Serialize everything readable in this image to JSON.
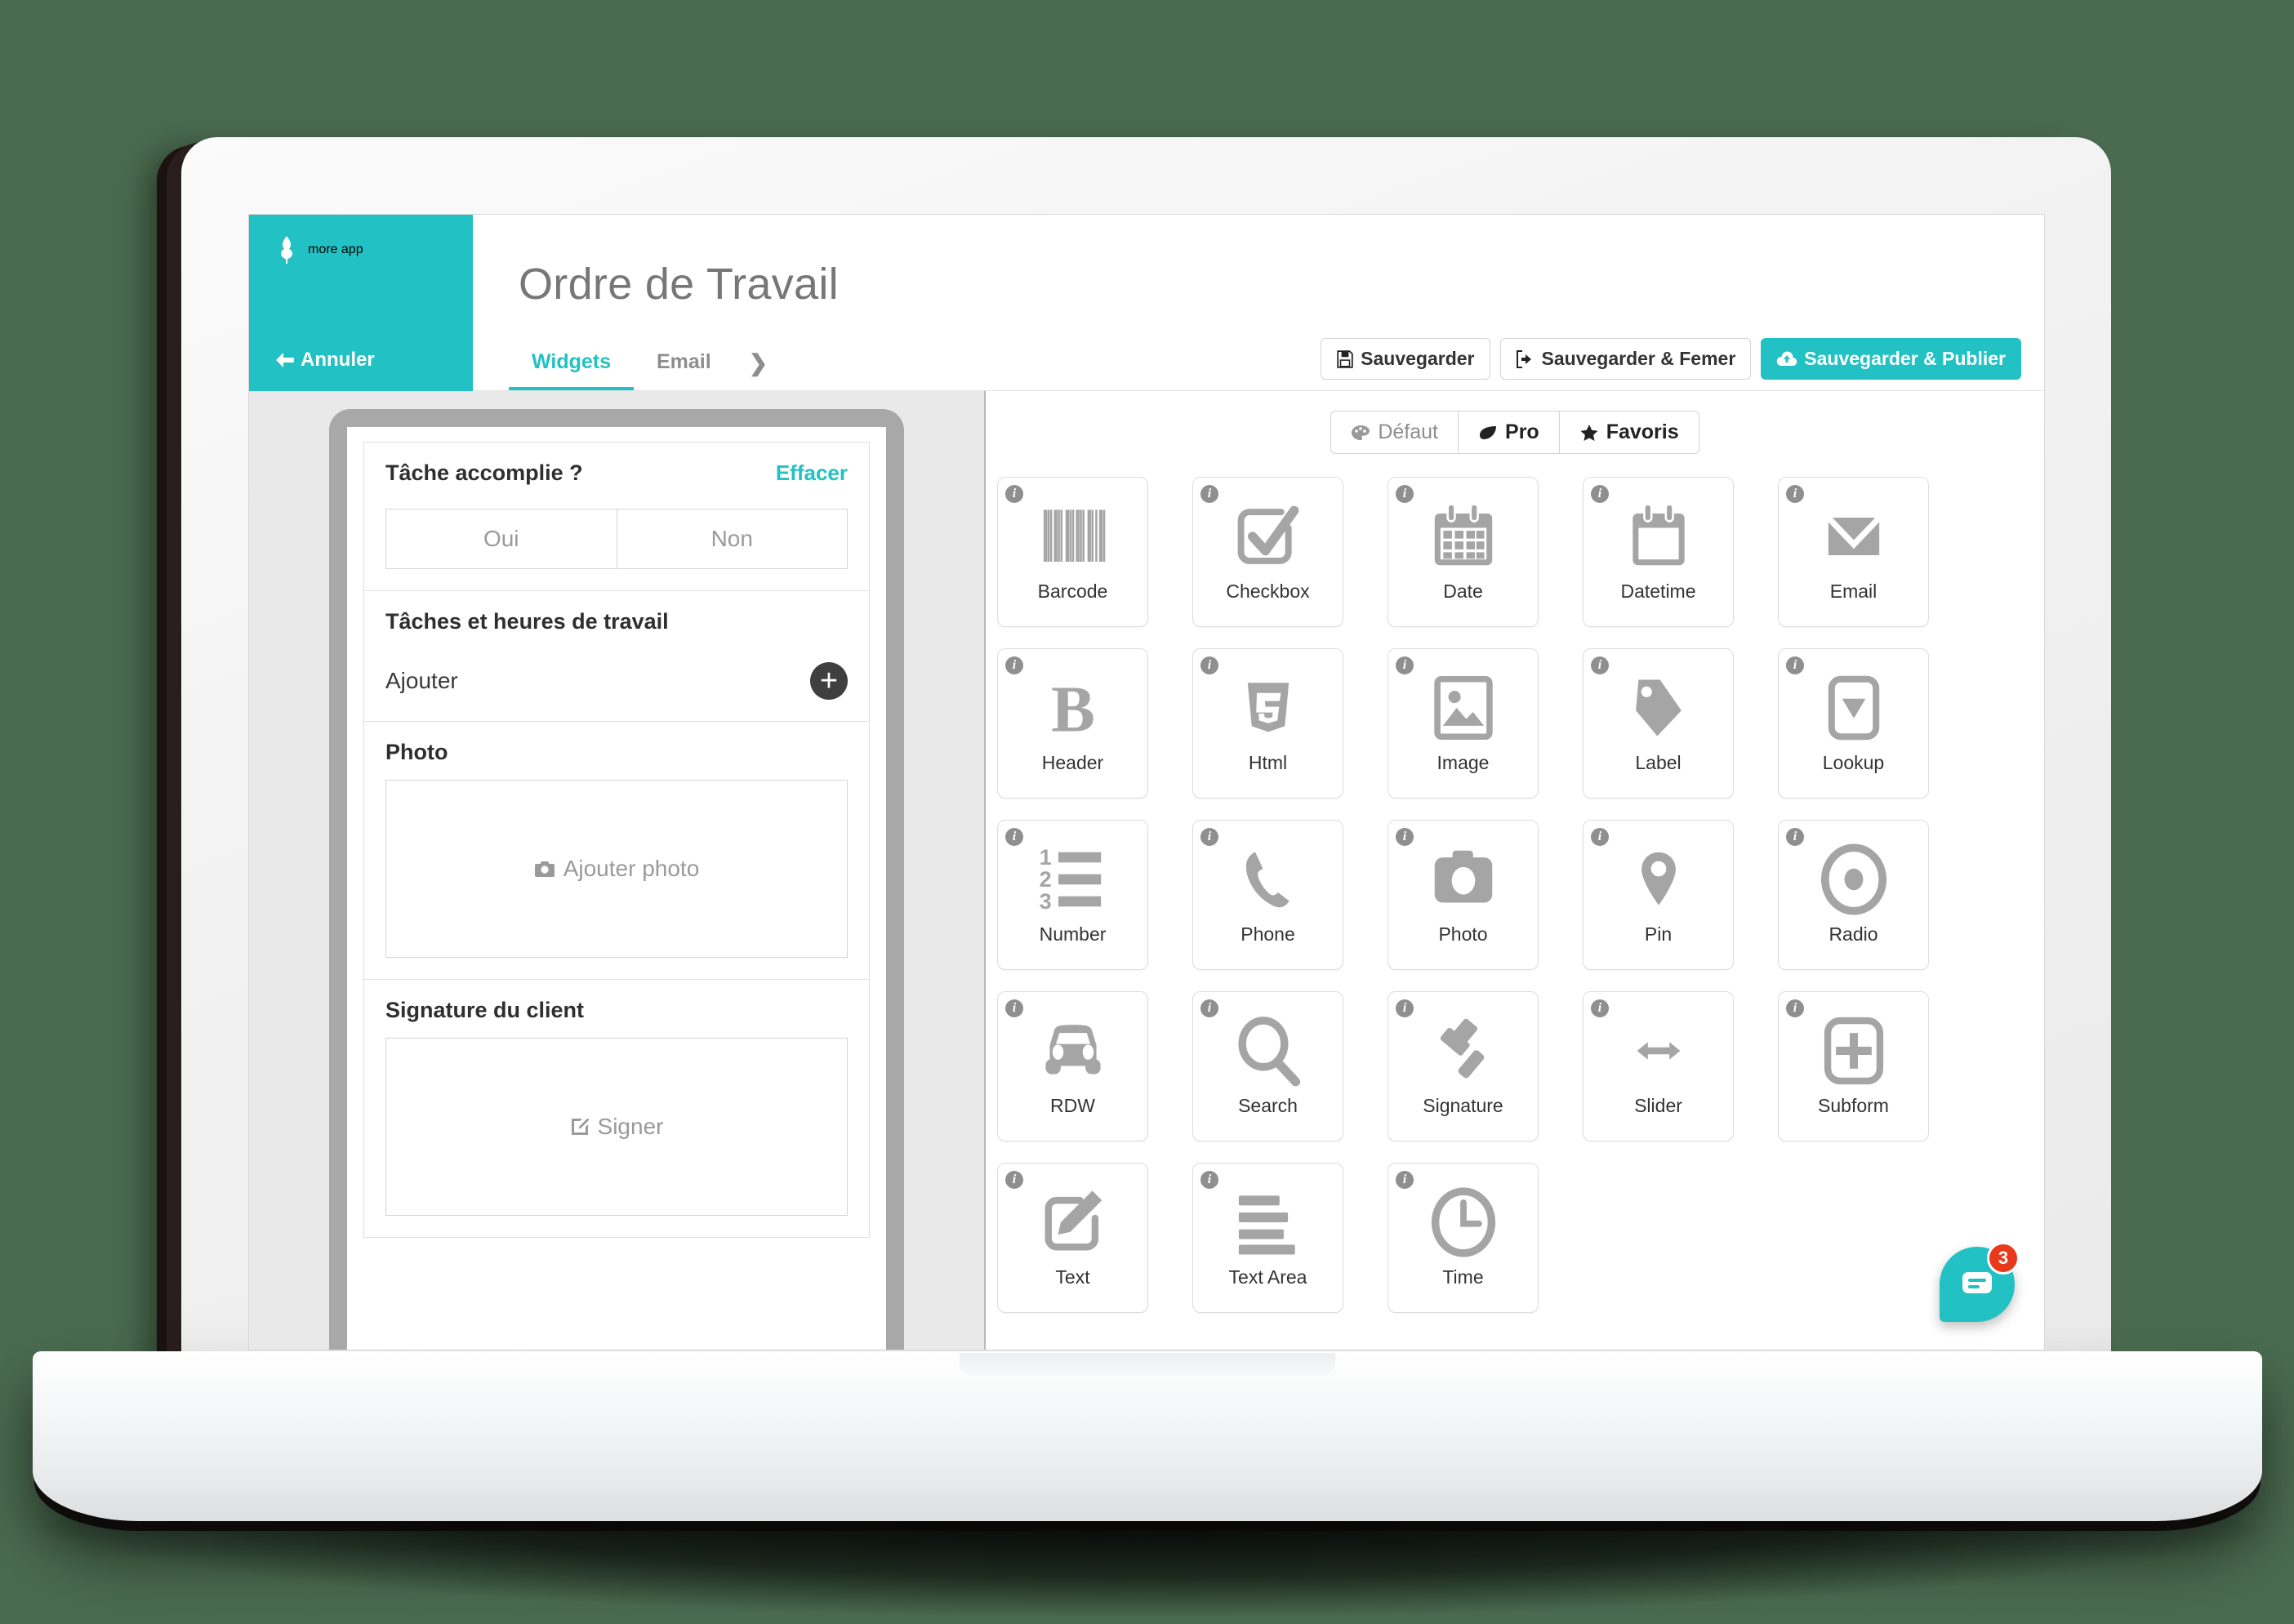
{
  "brand": {
    "name": "more app",
    "logo_icon": "leaf-icon"
  },
  "header": {
    "cancel_label": "Annuler",
    "cancel_icon": "arrow-left-icon",
    "title": "Ordre de Travail",
    "tabs": [
      {
        "label": "Widgets",
        "active": true
      },
      {
        "label": "Email",
        "active": false
      }
    ],
    "more_tabs_icon": "chevron-right-icon",
    "actions": [
      {
        "label": "Sauvegarder",
        "icon": "floppy-disk-icon",
        "primary": false
      },
      {
        "label": "Sauvegarder & Femer",
        "icon": "sign-out-icon",
        "primary": false
      },
      {
        "label": "Sauvegarder & Publier",
        "icon": "cloud-upload-icon",
        "primary": true
      }
    ]
  },
  "preview": {
    "task_done": {
      "label": "Tâche accomplie ?",
      "clear_label": "Effacer",
      "options": [
        "Oui",
        "Non"
      ]
    },
    "tasks_hours": {
      "label": "Tâches et heures de travail",
      "add_label": "Ajouter",
      "add_icon": "plus-icon"
    },
    "photo": {
      "label": "Photo",
      "placeholder": "Ajouter photo",
      "icon": "camera-icon"
    },
    "signature": {
      "label": "Signature du client",
      "placeholder": "Signer",
      "icon": "pen-square-icon"
    }
  },
  "widgets_panel": {
    "filters": [
      {
        "label": "Défaut",
        "icon": "palette-icon",
        "active": false
      },
      {
        "label": "Pro",
        "icon": "leaf-icon",
        "active": true
      },
      {
        "label": "Favoris",
        "icon": "star-icon",
        "active": false
      }
    ],
    "widgets": [
      {
        "label": "Barcode",
        "icon": "barcode-icon",
        "info_icon": "info-icon"
      },
      {
        "label": "Checkbox",
        "icon": "checkbox-icon",
        "info_icon": "info-icon"
      },
      {
        "label": "Date",
        "icon": "calendar-icon",
        "info_icon": "info-icon"
      },
      {
        "label": "Datetime",
        "icon": "calendar-blank-icon",
        "info_icon": "info-icon"
      },
      {
        "label": "Email",
        "icon": "envelope-icon",
        "info_icon": "info-icon"
      },
      {
        "label": "Header",
        "icon": "bold-b-icon",
        "info_icon": "info-icon"
      },
      {
        "label": "Html",
        "icon": "html5-icon",
        "info_icon": "info-icon"
      },
      {
        "label": "Image",
        "icon": "image-icon",
        "info_icon": "info-icon"
      },
      {
        "label": "Label",
        "icon": "tag-icon",
        "info_icon": "info-icon"
      },
      {
        "label": "Lookup",
        "icon": "dropdown-icon",
        "info_icon": "info-icon"
      },
      {
        "label": "Number",
        "icon": "numbered-list-icon",
        "info_icon": "info-icon"
      },
      {
        "label": "Phone",
        "icon": "phone-icon",
        "info_icon": "info-icon"
      },
      {
        "label": "Photo",
        "icon": "camera-icon",
        "info_icon": "info-icon"
      },
      {
        "label": "Pin",
        "icon": "map-pin-icon",
        "info_icon": "info-icon"
      },
      {
        "label": "Radio",
        "icon": "radio-button-icon",
        "info_icon": "info-icon"
      },
      {
        "label": "RDW",
        "icon": "car-icon",
        "info_icon": "info-icon"
      },
      {
        "label": "Search",
        "icon": "magnifier-icon",
        "info_icon": "info-icon"
      },
      {
        "label": "Signature",
        "icon": "gavel-icon",
        "info_icon": "info-icon"
      },
      {
        "label": "Slider",
        "icon": "arrows-horizontal-icon",
        "info_icon": "info-icon"
      },
      {
        "label": "Subform",
        "icon": "plus-square-icon",
        "info_icon": "info-icon"
      },
      {
        "label": "Text",
        "icon": "pen-square-icon",
        "info_icon": "info-icon"
      },
      {
        "label": "Text Area",
        "icon": "lines-icon",
        "info_icon": "info-icon"
      },
      {
        "label": "Time",
        "icon": "clock-icon",
        "info_icon": "info-icon"
      }
    ]
  },
  "chat": {
    "icon": "chat-bubble-icon",
    "badge": "3"
  },
  "colors": {
    "brand_teal": "#22c1c3",
    "badge_red": "#e8391b",
    "icon_grey": "#a5a5a5",
    "page_bg": "#4a6b4f"
  },
  "info_glyph": "i"
}
